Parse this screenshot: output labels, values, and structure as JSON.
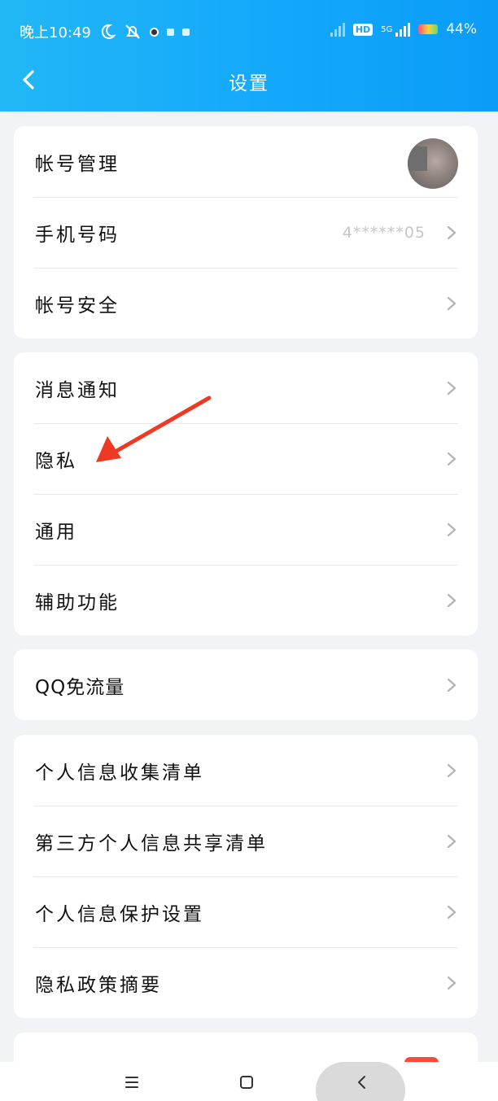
{
  "status_bar": {
    "time": "晚上10:49",
    "network": "5G",
    "hd": "HD",
    "battery": "44%"
  },
  "header": {
    "title": "设置"
  },
  "groups": [
    {
      "items": [
        {
          "label": "帐号管理"
        },
        {
          "label": "手机号码",
          "value": "4******05"
        },
        {
          "label": "帐号安全"
        }
      ]
    },
    {
      "items": [
        {
          "label": "消息通知"
        },
        {
          "label": "隐私"
        },
        {
          "label": "通用"
        },
        {
          "label": "辅助功能"
        }
      ]
    },
    {
      "items": [
        {
          "label": "QQ免流量"
        }
      ]
    },
    {
      "items": [
        {
          "label": "个人信息收集清单"
        },
        {
          "label": "第三方个人信息共享清单"
        },
        {
          "label": "个人信息保护设置"
        },
        {
          "label": "隐私政策摘要"
        }
      ]
    }
  ],
  "icons": {
    "back": "chevron-left-icon",
    "row_arrow": "chevron-right-icon"
  },
  "colors": {
    "header": "#12a7fb",
    "annotation_arrow": "#ee3a24",
    "badge": "#f44b3a"
  }
}
